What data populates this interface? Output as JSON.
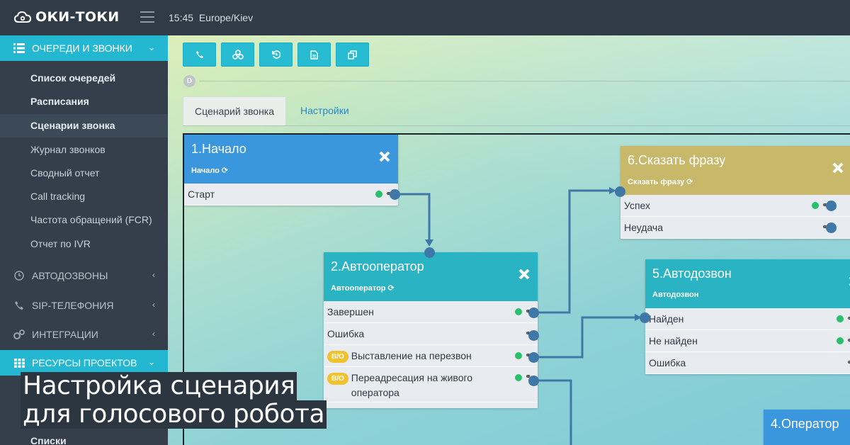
{
  "app": {
    "logo": "ОКИ-ТОКИ",
    "clock": "15:45",
    "timezone": "Europe/Kiev"
  },
  "sidebar": {
    "sections": [
      {
        "label": "ОЧЕРЕДИ И ЗВОНКИ",
        "icon": "list-icon",
        "expanded": true
      },
      {
        "label": "АВТОДОЗВОНЫ",
        "icon": "clock-icon",
        "expanded": false
      },
      {
        "label": "SIP-ТЕЛЕФОНИЯ",
        "icon": "phone-icon",
        "expanded": false
      },
      {
        "label": "ИНТЕГРАЦИИ",
        "icon": "gears-icon",
        "expanded": false
      },
      {
        "label": "РЕСУРСЫ ПРОЕКТОВ",
        "icon": "grid-icon",
        "expanded": true
      }
    ],
    "queue_items": [
      "Список очередей",
      "Расписания",
      "Сценарии звонка",
      "Журнал звонков",
      "Сводный отчет",
      "Call tracking",
      "Частота обращений (FCR)",
      "Отчет по IVR"
    ],
    "resource_items": [
      "Списки"
    ]
  },
  "toolbar": {
    "icons": [
      "phone-icon",
      "network-icon",
      "history-icon",
      "document-icon",
      "copy-icon"
    ]
  },
  "badge": "D",
  "tabs": [
    "Сценарий звонка",
    "Настройки"
  ],
  "nodes": {
    "n1": {
      "title": "1.Начало",
      "subtitle": "Начало",
      "rows": [
        "Старт"
      ],
      "color": "#3a97de"
    },
    "n2": {
      "title": "2.Автооператор",
      "subtitle": "Автооператор",
      "rows": [
        "Завершен",
        "Ошибка",
        "Выставление на перезвон",
        "Переадресация на живого оператора"
      ],
      "badge": "В/О",
      "color": "#2ab3c3"
    },
    "n6": {
      "title": "6.Сказать фразу",
      "subtitle": "Сказать фразу",
      "rows": [
        "Успех",
        "Неудача"
      ],
      "color": "#c8b86a"
    },
    "n5": {
      "title": "5.Автодозвон",
      "subtitle": "Автодозвон",
      "rows": [
        "Найден",
        "Не найден",
        "Ошибка"
      ],
      "color": "#2ab3c3"
    },
    "n4": {
      "title": "4.Оператор",
      "color": "#3a97de"
    }
  },
  "caption": {
    "line1": "Настройка сценария",
    "line2": "для голосового робота"
  },
  "colors": {
    "accent": "#23b7d2",
    "port": "#3f77a6",
    "ok": "#28c06a"
  }
}
